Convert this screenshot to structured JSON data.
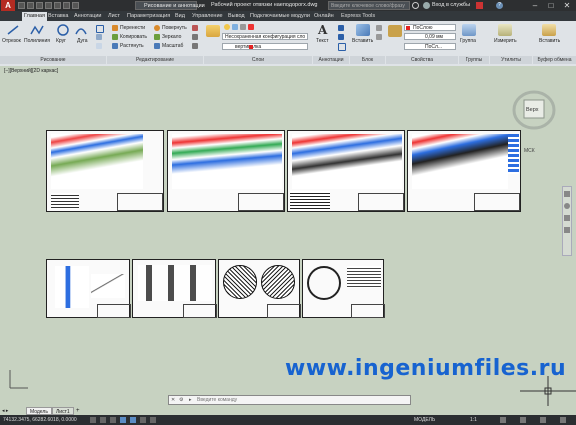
{
  "titlebar": {
    "workspace": "Рисование и аннотации",
    "filename": "Рабочий проект отвязки наеподорогх.dwg",
    "search_placeholder": "Введите ключевое слово/фразу",
    "signin": "Вход в службы"
  },
  "tabs": [
    "Главная",
    "Вставка",
    "Аннотации",
    "Лист",
    "Параметризация",
    "Вид",
    "Управление",
    "Вывод",
    "Подключаемые модули",
    "Онлайн",
    "Express Tools"
  ],
  "ribbon": {
    "draw_tools": [
      "Отрезок",
      "Полилиния",
      "Круг",
      "Дуга"
    ],
    "modify_tools": [
      "Перенести",
      "Повернуть",
      "Копировать",
      "Зеркало",
      "Растянуть",
      "Масштаб"
    ],
    "layer_combo": "Несохраненная конфигурация сло",
    "layer_current": "вертикалка",
    "text_tool": "Текст",
    "insert_tool": "Вставить",
    "prop_color": "ПоСлою",
    "prop_lineweight": "0,09 мм",
    "prop_linetype": "ПоСл...",
    "groups_tool": "Группа",
    "measure_tool": "Измерить",
    "paste_tool": "Вставить",
    "panels": [
      "Рисование",
      "Редактирование",
      "Слои",
      "Аннотации",
      "Блок",
      "Свойства",
      "Группы",
      "Утилиты",
      "Буфер обмена"
    ]
  },
  "viewport_label": "[−][Верхний][2D каркас]",
  "viewcube_label": "Верх",
  "viewcube_mck": "МСК",
  "watermark": "www.ingeniumfiles.ru",
  "command": {
    "placeholder": "Введите команду"
  },
  "layout_tabs": [
    "Модель",
    "Лист1"
  ],
  "status": {
    "coords": "74132.3475, 66282.6018, 0.0000",
    "mode": "МОДЕЛЬ",
    "scale": "1:1"
  }
}
